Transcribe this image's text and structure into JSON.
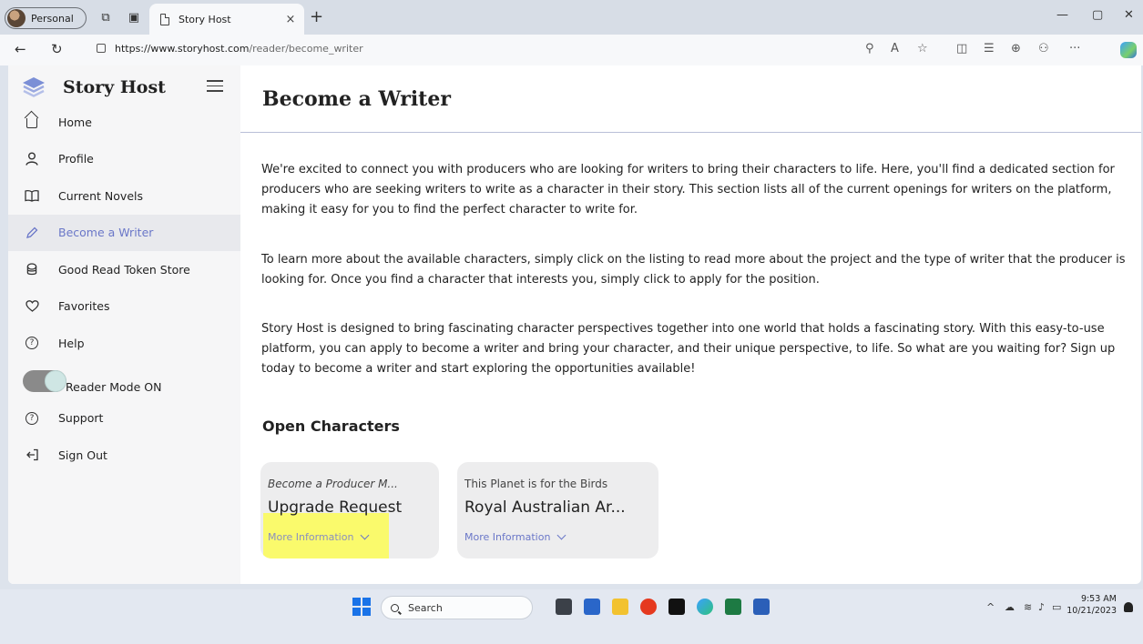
{
  "browser": {
    "profile_label": "Personal",
    "tab_title": "Story Host",
    "tab_close": "×",
    "new_tab": "+",
    "url_host": "https://www.storyhost.com",
    "url_path": "/reader/become_writer"
  },
  "sidebar": {
    "brand": "Story Host",
    "items": [
      {
        "label": "Home",
        "icon": "home-icon",
        "active": false
      },
      {
        "label": "Profile",
        "icon": "user-icon",
        "active": false
      },
      {
        "label": "Current Novels",
        "icon": "book-icon",
        "active": false
      },
      {
        "label": "Become a Writer",
        "icon": "pen-icon",
        "active": true
      },
      {
        "label": "Good Read Token Store",
        "icon": "token-icon",
        "active": false
      },
      {
        "label": "Favorites",
        "icon": "heart-icon",
        "active": false
      },
      {
        "label": "Help",
        "icon": "help-icon",
        "active": false
      }
    ],
    "reader_mode_label": "Reader Mode ON",
    "reader_mode_on": true,
    "bottom_items": [
      {
        "label": "Support",
        "icon": "support-icon"
      },
      {
        "label": "Sign Out",
        "icon": "sign-out-icon"
      }
    ]
  },
  "main": {
    "title": "Become a Writer",
    "paragraphs": [
      "We're excited to connect you with producers who are looking for writers to bring their characters to life. Here, you'll find a dedicated section for producers who are seeking writers to write as a character in their story. This section lists all of the current openings for writers on the platform, making it easy for you to find the perfect character to write for.",
      "To learn more about the available characters, simply click on the listing to read more about the project and the type of writer that the producer is looking for. Once you find a character that interests you, simply click to apply for the position.",
      "Story Host is designed to bring fascinating character perspectives together into one world that holds a fascinating story. With this easy-to-use platform, you can apply to become a writer and bring your character, and their unique perspective, to life. So what are you waiting for? Sign up today to become a writer and start exploring the opportunities available!"
    ],
    "section_title": "Open Characters",
    "cards": [
      {
        "subtitle": "Become a Producer M...",
        "title": "Upgrade Request",
        "more": "More Information"
      },
      {
        "subtitle": "This Planet is for the Birds",
        "title": "Royal Australian Ar...",
        "more": "More Information"
      }
    ]
  },
  "taskbar": {
    "search_label": "Search",
    "time": "9:53 AM",
    "date": "10/21/2023"
  },
  "colors": {
    "accent": "#6a77c8",
    "highlight": "#fbfb55"
  }
}
